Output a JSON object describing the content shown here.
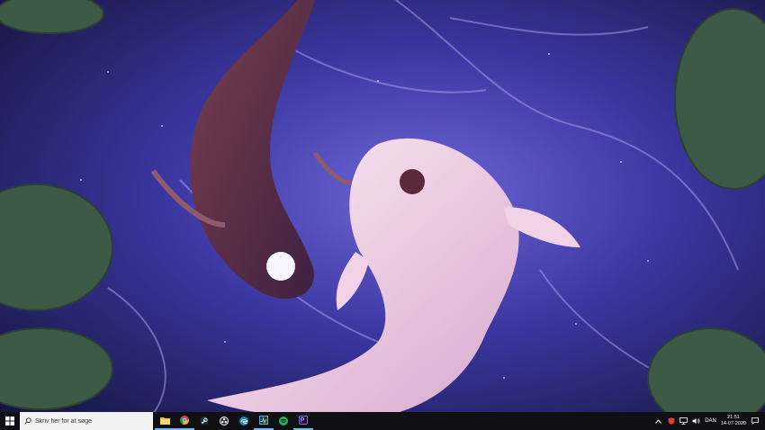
{
  "search": {
    "placeholder": "Skriv her for at søge",
    "icon": "search-icon"
  },
  "taskbar_apps": [
    {
      "name": "file-explorer-icon",
      "color": "#f4c542",
      "active": true
    },
    {
      "name": "chrome-icon",
      "color": "#db4437",
      "active": true
    },
    {
      "name": "steam-icon",
      "color": "#1b2838",
      "active": false
    },
    {
      "name": "obs-icon",
      "color": "#ffffff",
      "active": false
    },
    {
      "name": "edge-icon",
      "color": "#0f8ad8",
      "active": false
    },
    {
      "name": "task-manager-icon",
      "color": "#5fa8d3",
      "active": true
    },
    {
      "name": "spotify-icon",
      "color": "#1db954",
      "active": false
    },
    {
      "name": "premiere-icon",
      "color": "#9999ff",
      "active": true
    }
  ],
  "tray": {
    "language": "DAN",
    "time": "21:51",
    "date": "14-07-2020"
  },
  "colors": {
    "taskbar": "#101014",
    "accent": "#76b9ed"
  }
}
